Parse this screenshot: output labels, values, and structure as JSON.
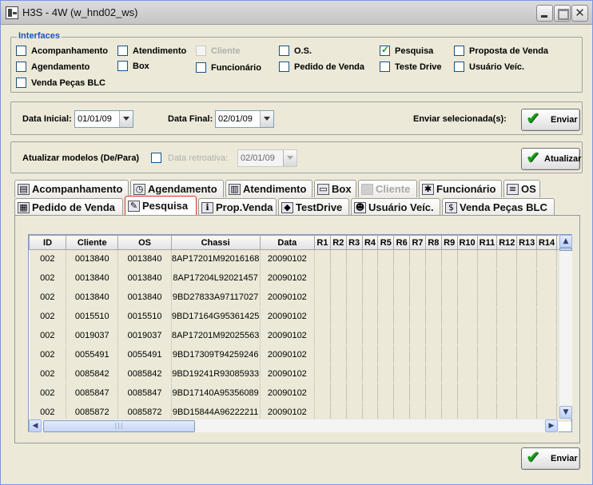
{
  "window": {
    "title": "H3S - 4W (w_hnd02_ws)",
    "close_glyph": "✕"
  },
  "interfaces": {
    "title": "Interfaces",
    "items": [
      {
        "label": "Acompanhamento",
        "checked": false,
        "enabled": true
      },
      {
        "label": "Atendimento",
        "checked": false,
        "enabled": true
      },
      {
        "label": "Cliente",
        "checked": false,
        "enabled": false
      },
      {
        "label": "O.S.",
        "checked": false,
        "enabled": true
      },
      {
        "label": "Pesquisa",
        "checked": true,
        "enabled": true
      },
      {
        "label": "Proposta de Venda",
        "checked": false,
        "enabled": true
      },
      {
        "label": "Agendamento",
        "checked": false,
        "enabled": true
      },
      {
        "label": "Box",
        "checked": false,
        "enabled": true
      },
      {
        "label": "Funcionário",
        "checked": false,
        "enabled": true
      },
      {
        "label": "Pedido de Venda",
        "checked": false,
        "enabled": true
      },
      {
        "label": "Teste Drive",
        "checked": false,
        "enabled": true
      },
      {
        "label": "Usuário Veíc.",
        "checked": false,
        "enabled": true
      },
      {
        "label": "Venda Peças BLC",
        "checked": false,
        "enabled": true
      }
    ]
  },
  "dates": {
    "inicial_label": "Data Inicial:",
    "inicial_value": "01/01/09",
    "final_label": "Data Final:",
    "final_value": "02/01/09",
    "enviar_sel_label": "Enviar selecionada(s):",
    "enviar_button": "Enviar"
  },
  "atualizar": {
    "label": "Atualizar modelos (De/Para)",
    "checked": false,
    "retro_label": "Data retroativa:",
    "retro_value": "02/01/09",
    "button": "Atualizar"
  },
  "tabs_row1": [
    {
      "label": "Acompanhamento",
      "icon": "film-icon",
      "glyph": "▤"
    },
    {
      "label": "Agendamento",
      "icon": "calendar-clock-icon",
      "glyph": "◷"
    },
    {
      "label": "Atendimento",
      "icon": "database-icon",
      "glyph": "▥"
    },
    {
      "label": "Box",
      "icon": "window-icon",
      "glyph": "▭"
    },
    {
      "label": "Cliente",
      "icon": "client-icon",
      "glyph": ""
    },
    {
      "label": "Funcionário",
      "icon": "people-icon",
      "glyph": "✱"
    },
    {
      "label": "OS",
      "icon": "list-icon",
      "glyph": "≡"
    }
  ],
  "tabs_row2": [
    {
      "label": "Pedido de Venda",
      "icon": "grid-icon",
      "glyph": "▦"
    },
    {
      "label": "Pesquisa",
      "icon": "search-person-icon",
      "glyph": "✎"
    },
    {
      "label": "Prop.Venda",
      "icon": "info-icon",
      "glyph": "ℹ"
    },
    {
      "label": "TestDrive",
      "icon": "car-icon",
      "glyph": "◆"
    },
    {
      "label": "Usuário Veíc.",
      "icon": "user-icon",
      "glyph": "☻"
    },
    {
      "label": "Venda Peças BLC",
      "icon": "dollar-icon",
      "glyph": "$"
    }
  ],
  "table": {
    "columns": [
      "ID",
      "Cliente",
      "OS",
      "Chassi",
      "Data",
      "R1",
      "R2",
      "R3",
      "R4",
      "R5",
      "R6",
      "R7",
      "R8",
      "R9",
      "R10",
      "R11",
      "R12",
      "R13",
      "R14",
      "R1"
    ],
    "rows": [
      [
        "002",
        "0013840",
        "0013840",
        "8AP17201M92016168",
        "20090102"
      ],
      [
        "002",
        "0013840",
        "0013840",
        "8AP17204L92021457",
        "20090102"
      ],
      [
        "002",
        "0013840",
        "0013840",
        "9BD27833A97117027",
        "20090102"
      ],
      [
        "002",
        "0015510",
        "0015510",
        "9BD17164G95361425",
        "20090102"
      ],
      [
        "002",
        "0019037",
        "0019037",
        "8AP17201M92025563",
        "20090102"
      ],
      [
        "002",
        "0055491",
        "0055491",
        "9BD17309T94259246",
        "20090102"
      ],
      [
        "002",
        "0085842",
        "0085842",
        "9BD19241R93085933",
        "20090102"
      ],
      [
        "002",
        "0085847",
        "0085847",
        "9BD17140A95356089",
        "20090102"
      ],
      [
        "002",
        "0085872",
        "0085872",
        "9BD15844A96222211",
        "20090102"
      ]
    ]
  },
  "footer": {
    "enviar_button": "Enviar"
  },
  "scroll": {
    "up": "▲",
    "down": "▼",
    "left": "◀",
    "right": "▶",
    "grip": "|||"
  },
  "colors": {
    "accent": "#1e4fc8",
    "check_green": "#1b9e1b",
    "active_tab_border": "#cf3b2a"
  }
}
